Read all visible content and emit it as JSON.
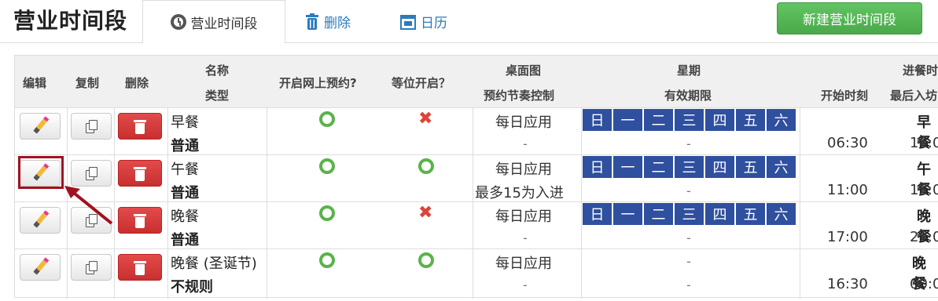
{
  "header": {
    "title": "营业时间段",
    "tabs": [
      {
        "label": "营业时间段",
        "icon": "clock-icon",
        "active": true
      },
      {
        "label": "删除",
        "icon": "trash-icon"
      },
      {
        "label": "日历",
        "icon": "calendar-icon"
      }
    ],
    "new_button": "新建营业时间段"
  },
  "columns": {
    "edit": "编辑",
    "copy": "复制",
    "delete": "删除",
    "name": "名称",
    "type": "类型",
    "online": "开启网上预约?",
    "waitlist": "等位开启？",
    "table_map": "桌面图",
    "pacing": "预约节奏控制",
    "week": "星期",
    "validity": "有效期限",
    "dining": "进餐时",
    "start_time": "开始时刻",
    "last_seating": "最后入坊"
  },
  "weekdays": [
    "日",
    "一",
    "二",
    "三",
    "四",
    "五",
    "六"
  ],
  "rows": [
    {
      "name": "早餐",
      "type": "普通",
      "online": true,
      "waitlist": false,
      "table_map": "每日应用",
      "pacing": "-",
      "days": true,
      "validity": "-",
      "start": "06:30",
      "meal": "早餐",
      "last": "10:0"
    },
    {
      "name": "午餐",
      "type": "普通",
      "online": true,
      "waitlist": true,
      "table_map": "每日应用",
      "pacing": "最多15为入进",
      "days": true,
      "validity": "-",
      "start": "11:00",
      "meal": "午餐",
      "last": "15:0"
    },
    {
      "name": "晚餐",
      "type": "普通",
      "online": true,
      "waitlist": false,
      "table_map": "每日应用",
      "pacing": "-",
      "days": true,
      "validity": "-",
      "start": "17:00",
      "meal": "晚餐",
      "last": "21:0"
    },
    {
      "name": "晚餐 (圣诞节)",
      "type": "不规则",
      "online": true,
      "waitlist": true,
      "table_map": "每日应用",
      "pacing": "-",
      "days": false,
      "validity": "-",
      "start": "16:30",
      "meal": "晚餐",
      "last": "00:0"
    }
  ],
  "colors": {
    "accent": "#2a7bbf",
    "success": "#5ab34a",
    "danger": "#d9453a",
    "day_bg": "#2f4f9f",
    "highlight": "#a1121f"
  }
}
